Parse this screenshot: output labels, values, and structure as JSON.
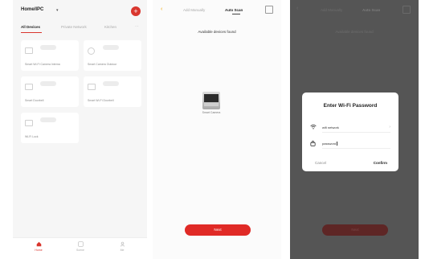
{
  "colors": {
    "accent": "#d9362e",
    "next_button": "#e02a26",
    "overlay": "#555555"
  },
  "home": {
    "title": "Home/IPC",
    "add_icon": "plus-icon",
    "tabs": [
      "All Devices",
      "Private Network",
      "Kitchen"
    ],
    "more_icon": "more-icon",
    "devices": [
      {
        "label": "Smart Wi-Fi Camera Interna",
        "icon": "camera-icon"
      },
      {
        "label": "Smart Camera Outdoor",
        "icon": "bulb-icon"
      },
      {
        "label": "Smart Doorbell",
        "icon": "plug-icon"
      },
      {
        "label": "Smart Wi-Fi Doorbell",
        "icon": "doorbell-icon"
      },
      {
        "label": "Wi-Fi Lock",
        "icon": "lock-icon"
      }
    ],
    "nav": [
      {
        "label": "Home",
        "icon": "home-icon"
      },
      {
        "label": "Scene",
        "icon": "scene-icon"
      },
      {
        "label": "Me",
        "icon": "profile-icon"
      }
    ]
  },
  "scan": {
    "back_icon": "back-arrow-icon",
    "tabs": [
      "Add Manually",
      "Auto Scan"
    ],
    "scan_icon": "scan-icon",
    "status": "Available devices found",
    "device_name": "Smart Camera",
    "next_label": "Next"
  },
  "wifi_dialog": {
    "title": "Enter Wi-Fi Password",
    "ssid": "wifi network",
    "password": "password",
    "wifi_icon": "wifi-icon",
    "lock_icon": "lock-icon",
    "cancel": "Cancel",
    "confirm": "Confirm"
  }
}
